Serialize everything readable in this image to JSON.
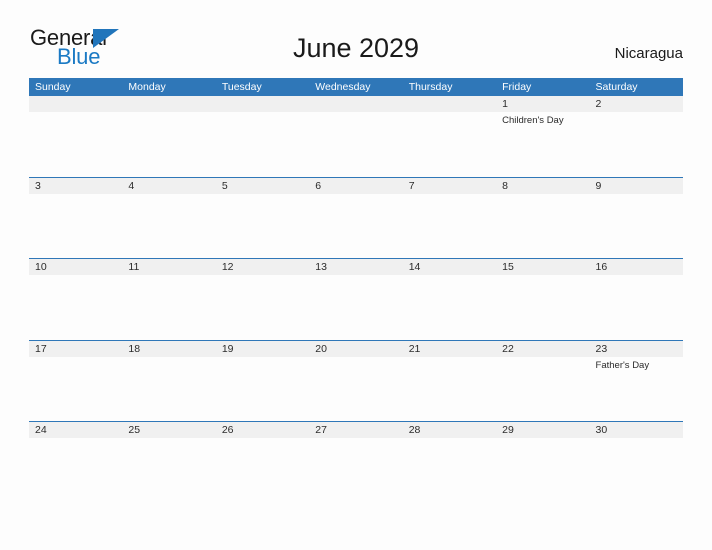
{
  "brand": {
    "name_part1": "General",
    "name_part2": "Blue",
    "flag_icon": "blue-triangle-flag-icon",
    "color_primary": "#1b7ac4",
    "color_flag": "#2175bb",
    "color_text": "#1a1a1a"
  },
  "header": {
    "title": "June 2029",
    "country": "Nicaragua"
  },
  "calendar": {
    "accent_color": "#2f77b8",
    "date_band_color": "#f0f0f0",
    "weekdays": [
      "Sunday",
      "Monday",
      "Tuesday",
      "Wednesday",
      "Thursday",
      "Friday",
      "Saturday"
    ],
    "weeks": [
      {
        "days": [
          {
            "num": "",
            "events": []
          },
          {
            "num": "",
            "events": []
          },
          {
            "num": "",
            "events": []
          },
          {
            "num": "",
            "events": []
          },
          {
            "num": "",
            "events": []
          },
          {
            "num": "1",
            "events": [
              "Children's Day"
            ]
          },
          {
            "num": "2",
            "events": []
          }
        ]
      },
      {
        "days": [
          {
            "num": "3",
            "events": []
          },
          {
            "num": "4",
            "events": []
          },
          {
            "num": "5",
            "events": []
          },
          {
            "num": "6",
            "events": []
          },
          {
            "num": "7",
            "events": []
          },
          {
            "num": "8",
            "events": []
          },
          {
            "num": "9",
            "events": []
          }
        ]
      },
      {
        "days": [
          {
            "num": "10",
            "events": []
          },
          {
            "num": "11",
            "events": []
          },
          {
            "num": "12",
            "events": []
          },
          {
            "num": "13",
            "events": []
          },
          {
            "num": "14",
            "events": []
          },
          {
            "num": "15",
            "events": []
          },
          {
            "num": "16",
            "events": []
          }
        ]
      },
      {
        "days": [
          {
            "num": "17",
            "events": []
          },
          {
            "num": "18",
            "events": []
          },
          {
            "num": "19",
            "events": []
          },
          {
            "num": "20",
            "events": []
          },
          {
            "num": "21",
            "events": []
          },
          {
            "num": "22",
            "events": []
          },
          {
            "num": "23",
            "events": [
              "Father's Day"
            ]
          }
        ]
      },
      {
        "days": [
          {
            "num": "24",
            "events": []
          },
          {
            "num": "25",
            "events": []
          },
          {
            "num": "26",
            "events": []
          },
          {
            "num": "27",
            "events": []
          },
          {
            "num": "28",
            "events": []
          },
          {
            "num": "29",
            "events": []
          },
          {
            "num": "30",
            "events": []
          }
        ]
      }
    ]
  }
}
